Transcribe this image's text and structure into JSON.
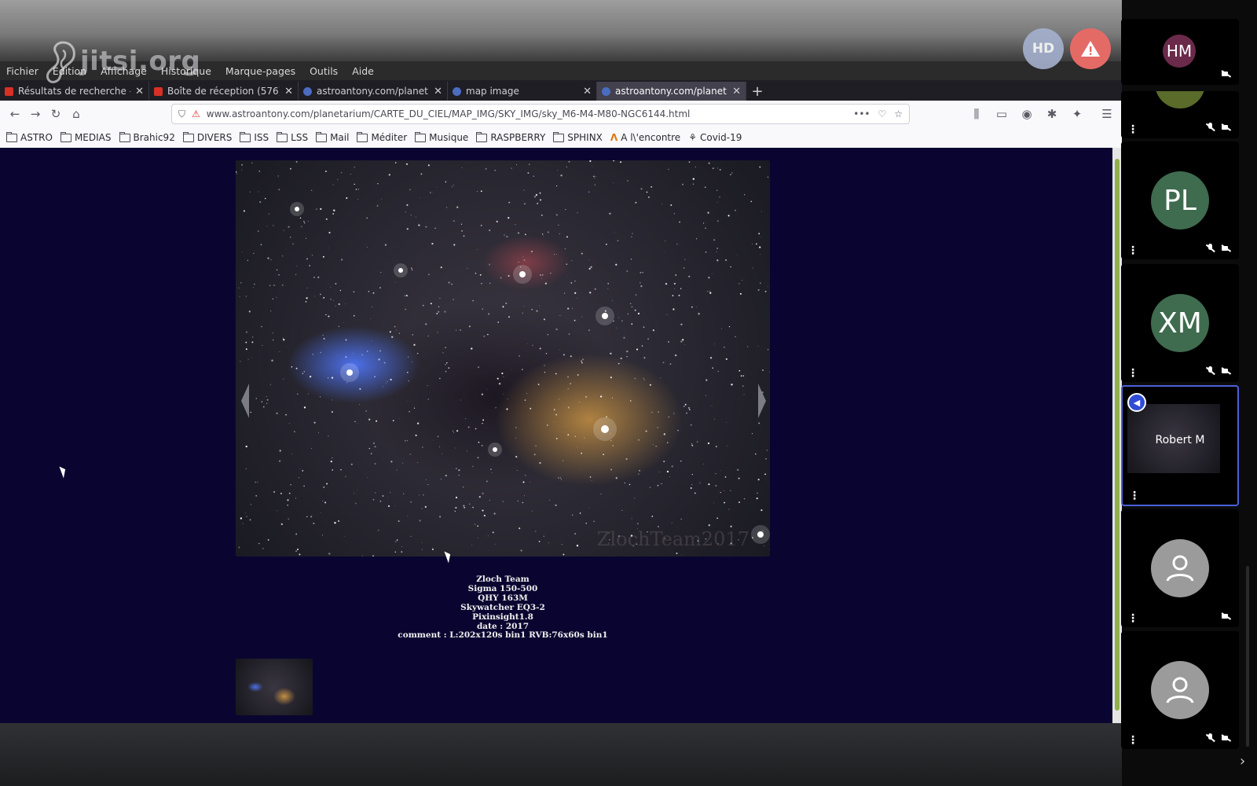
{
  "watermark": {
    "text": "jitsi.org"
  },
  "badges": {
    "hd": "HD",
    "warning_icon": "warning-icon"
  },
  "browser": {
    "menu": [
      "Fichier",
      "Édition",
      "Affichage",
      "Historique",
      "Marque-pages",
      "Outils",
      "Aide"
    ],
    "tabs": [
      {
        "title": "Résultats de recherche -",
        "favicon_color": "#d93025"
      },
      {
        "title": "Boîte de réception (576)",
        "favicon_color": "#d93025"
      },
      {
        "title": "astroantony.com/planet",
        "favicon_color": "#4b6cc1"
      },
      {
        "title": "map image",
        "favicon_color": "#4b6cc1"
      },
      {
        "title": "astroantony.com/planet",
        "favicon_color": "#4b6cc1",
        "active": true
      }
    ],
    "new_tab": "+",
    "url": "www.astroantony.com/planetarium/CARTE_DU_CIEL/MAP_IMG/SKY_IMG/sky_M6-M4-M80-NGC6144.html",
    "url_actions": [
      "•••",
      "♡",
      "☆"
    ],
    "bookmarks": [
      {
        "label": "ASTRO",
        "type": "folder"
      },
      {
        "label": "MEDIAS",
        "type": "folder"
      },
      {
        "label": "Brahic92",
        "type": "folder"
      },
      {
        "label": "DIVERS",
        "type": "folder"
      },
      {
        "label": "ISS",
        "type": "folder"
      },
      {
        "label": "LSS",
        "type": "folder"
      },
      {
        "label": "Mail",
        "type": "folder"
      },
      {
        "label": "Méditer",
        "type": "folder"
      },
      {
        "label": "Musique",
        "type": "folder"
      },
      {
        "label": "RASPBERRY",
        "type": "folder"
      },
      {
        "label": "SPHINX",
        "type": "folder"
      },
      {
        "label": "A l\\'encontre",
        "type": "link"
      },
      {
        "label": "Covid-19",
        "type": "link"
      }
    ]
  },
  "page": {
    "photo_watermark": "ZlochTeam2017",
    "caption": [
      "Zloch Team",
      "Sigma 150-500",
      "QHY 163M",
      "Skywatcher EQ3-2",
      "Pixinsight1.8",
      "date : 2017",
      "comment : L:202x120s bin1 RVB:76x60s bin1"
    ],
    "background": "#0a0530"
  },
  "participants": [
    {
      "initials": "HM",
      "color": "#6b2a4a",
      "muted": false,
      "camera_off": true
    },
    {
      "initials": "",
      "color": "#5a6b2a",
      "muted": true,
      "camera_off": true
    },
    {
      "initials": "PL",
      "color": "#3f6b4f",
      "muted": true,
      "camera_off": true
    },
    {
      "initials": "XM",
      "color": "#3f6b4f",
      "muted": true,
      "camera_off": true
    },
    {
      "name": "Robert M",
      "active": true,
      "muted": false,
      "camera_off": false
    },
    {
      "initials": "",
      "color": "#9b9b9b",
      "placeholder": true,
      "muted": false,
      "camera_off": true
    },
    {
      "initials": "",
      "color": "#9b9b9b",
      "placeholder": true,
      "muted": true,
      "camera_off": true
    }
  ]
}
